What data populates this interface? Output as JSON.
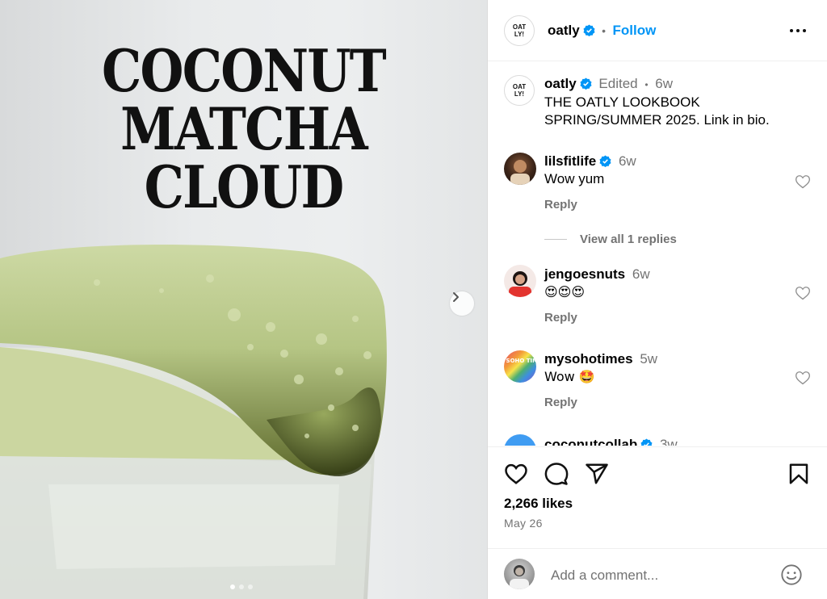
{
  "post": {
    "poster_lines": [
      "COCONUT",
      "MATCHA",
      "CLOUD"
    ],
    "carousel": {
      "total_slides": 3,
      "active_slide": 1
    }
  },
  "header": {
    "username": "oatly",
    "separator": "•",
    "follow_label": "Follow",
    "logo_text": "OAT LY!"
  },
  "caption": {
    "username": "oatly",
    "edited": "Edited",
    "separator": "•",
    "time": "6w",
    "text": "THE OATLY LOOKBOOK SPRING/SUMMER 2025. Link in bio."
  },
  "comments": [
    {
      "username": "lilsfitlife",
      "verified": true,
      "time": "6w",
      "text": "Wow yum",
      "reply_label": "Reply",
      "view_replies": "View all 1 replies"
    },
    {
      "username": "jengoesnuts",
      "verified": false,
      "time": "6w",
      "text": "😍😍😍",
      "reply_label": "Reply"
    },
    {
      "username": "mysohotimes",
      "verified": false,
      "time": "5w",
      "text": "Wow 🤩",
      "reply_label": "Reply",
      "avatar_text": "MY SOHO TIMES"
    },
    {
      "username": "coconutcollab",
      "verified": true,
      "time": "3w"
    }
  ],
  "footer": {
    "likes": "2,266 likes",
    "date": "May 26",
    "comment_placeholder": "Add a comment..."
  },
  "colors": {
    "link": "#0095f6",
    "muted": "#737373",
    "verified": "#0095f6",
    "matcha": "#b9c98a"
  },
  "icons": [
    "more-icon",
    "heart-icon",
    "comment-icon",
    "share-icon",
    "bookmark-icon",
    "emoji-icon",
    "chevron-right-icon",
    "verified-icon"
  ]
}
